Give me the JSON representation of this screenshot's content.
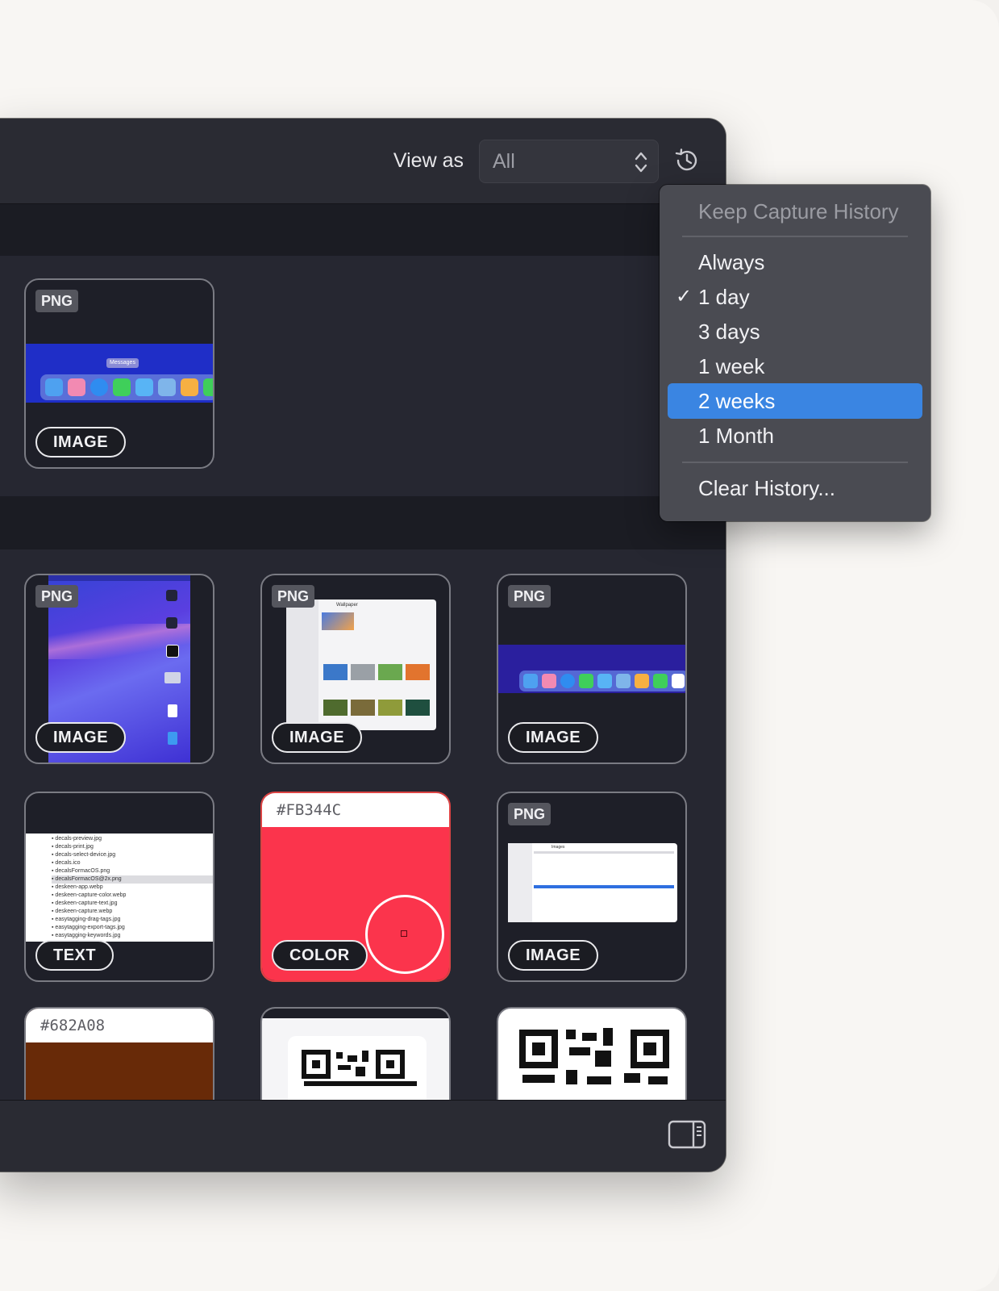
{
  "toolbar": {
    "view_as_label": "View as",
    "view_as_value": "All",
    "history_icon": "clock-history-icon"
  },
  "sections": [
    {
      "cards": [
        {
          "badge": "PNG",
          "type": "IMAGE"
        }
      ]
    },
    {
      "cards": [
        {
          "badge": "PNG",
          "type": "IMAGE"
        },
        {
          "badge": "PNG",
          "type": "IMAGE"
        },
        {
          "badge": "PNG",
          "type": "IMAGE"
        },
        {
          "badge": "",
          "type": "TEXT"
        },
        {
          "hex": "#FB344C",
          "type": "COLOR",
          "color": "#FB344C"
        },
        {
          "badge": "PNG",
          "type": "IMAGE"
        },
        {
          "hex": "#682A08",
          "type": "COLOR",
          "color": "#682A08"
        },
        {
          "badge": "",
          "type": ""
        },
        {
          "badge": "",
          "type": ""
        }
      ]
    }
  ],
  "thumbs": {
    "messages_tooltip": "Messages",
    "wallpaper_title": "Wallpaper",
    "text_files": [
      "decals-preview.jpg",
      "decals-print.jpg",
      "decals-select-device.jpg",
      "decals.ico",
      "decalsFormacOS.png",
      "decalsFormacOS@2x.png",
      "deskeen-app.webp",
      "deskeen-capture-color.webp",
      "deskeen-capture-text.jpg",
      "deskeen-capture.webp",
      "easytagging-drag-tags.jpg",
      "easytagging-export-tags.jpg",
      "easytagging-keywords.jpg"
    ],
    "finder_title": "Images"
  },
  "menu": {
    "heading": "Keep Capture History",
    "items": [
      "Always",
      "1 day",
      "3 days",
      "1 week",
      "2 weeks",
      "1 Month"
    ],
    "checked_item": "1 day",
    "highlighted_item": "2 weeks",
    "clear_label": "Clear History..."
  },
  "footer": {
    "sidebar_icon": "sidebar-toggle-icon"
  },
  "colors": {
    "window_bg": "#1f2029",
    "accent": "#3a85e2",
    "menu_bg": "#4a4b52"
  }
}
